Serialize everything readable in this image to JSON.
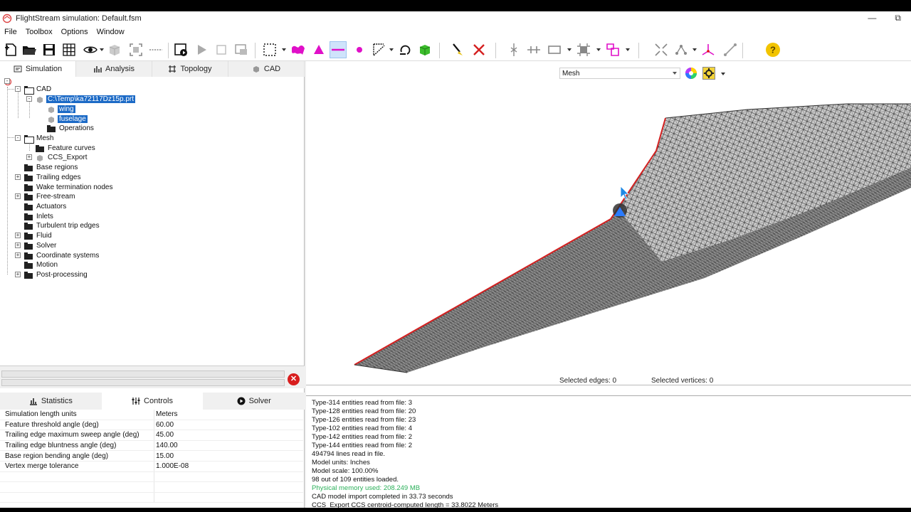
{
  "window": {
    "title": "FlightStream simulation: Default.fsm",
    "minimize": "—",
    "restore": "⧉"
  },
  "menu": [
    "File",
    "Toolbox",
    "Options",
    "Window"
  ],
  "colors": {
    "selection": "#1c6ac6",
    "edge_highlight": "#d42020",
    "console_green": "#2bb05a",
    "stop": "#d81e1e"
  },
  "left_tabs": [
    {
      "label": "Simulation",
      "icon": "simulation-icon",
      "active": true
    },
    {
      "label": "Analysis",
      "icon": "analysis-icon",
      "active": false
    },
    {
      "label": "Topology",
      "icon": "topology-icon",
      "active": false
    },
    {
      "label": "CAD",
      "icon": "cad-icon",
      "active": false
    }
  ],
  "tree": {
    "cad": "CAD",
    "cad_file": "C:\\Temp\\ka72117Dz15p.prt",
    "wing": "wing",
    "fuselage": "fuselage",
    "operations": "Operations",
    "mesh": "Mesh",
    "feature_curves": "Feature curves",
    "ccs_export": "CCS_Export",
    "base_regions": "Base regions",
    "trailing_edges": "Trailing edges",
    "wake_nodes": "Wake termination nodes",
    "free_stream": "Free-stream",
    "actuators": "Actuators",
    "inlets": "Inlets",
    "turbulent": "Turbulent trip edges",
    "fluid": "Fluid",
    "solver": "Solver",
    "coord": "Coordinate systems",
    "motion": "Motion",
    "post": "Post-processing"
  },
  "bottom_tabs": [
    {
      "label": "Statistics",
      "icon": "statistics-icon"
    },
    {
      "label": "Controls",
      "icon": "controls-icon"
    },
    {
      "label": "Solver",
      "icon": "solver-play-icon"
    }
  ],
  "stop_glyph": "✕",
  "properties": [
    {
      "key": "Simulation length units",
      "value": "Meters"
    },
    {
      "key": "Feature threshold angle (deg)",
      "value": "60.00"
    },
    {
      "key": "Trailing edge maximum sweep angle (deg)",
      "value": "45.00"
    },
    {
      "key": "Trailing edge bluntness angle (deg)",
      "value": "140.00"
    },
    {
      "key": "Base region bending angle (deg)",
      "value": "15.00"
    },
    {
      "key": "Vertex merge tolerance",
      "value": "1.000E-08"
    }
  ],
  "viewport": {
    "display_mode": "Mesh",
    "selected_edges": "Selected edges: 0",
    "selected_vertices": "Selected vertices: 0"
  },
  "console": [
    {
      "text": "Type-314 entities read from file: 3",
      "green": false
    },
    {
      "text": "Type-128 entities read from file: 20",
      "green": false
    },
    {
      "text": "Type-126 entities read from file: 23",
      "green": false
    },
    {
      "text": "Type-102 entities read from file: 4",
      "green": false
    },
    {
      "text": "Type-142 entities read from file: 2",
      "green": false
    },
    {
      "text": "Type-144 entities read from file: 2",
      "green": false
    },
    {
      "text": "494794 lines read in file.",
      "green": false
    },
    {
      "text": "Model units: Inches",
      "green": false
    },
    {
      "text": "Model scale: 100.00%",
      "green": false
    },
    {
      "text": "98 out of 109 entities loaded.",
      "green": false
    },
    {
      "text": "Physical memory used: 208.249 MB",
      "green": true
    },
    {
      "text": "CAD model import completed in 33.73 seconds",
      "green": false
    },
    {
      "text": "CCS_Export CCS centroid-computed length = 33.8022 Meters",
      "green": false
    }
  ]
}
